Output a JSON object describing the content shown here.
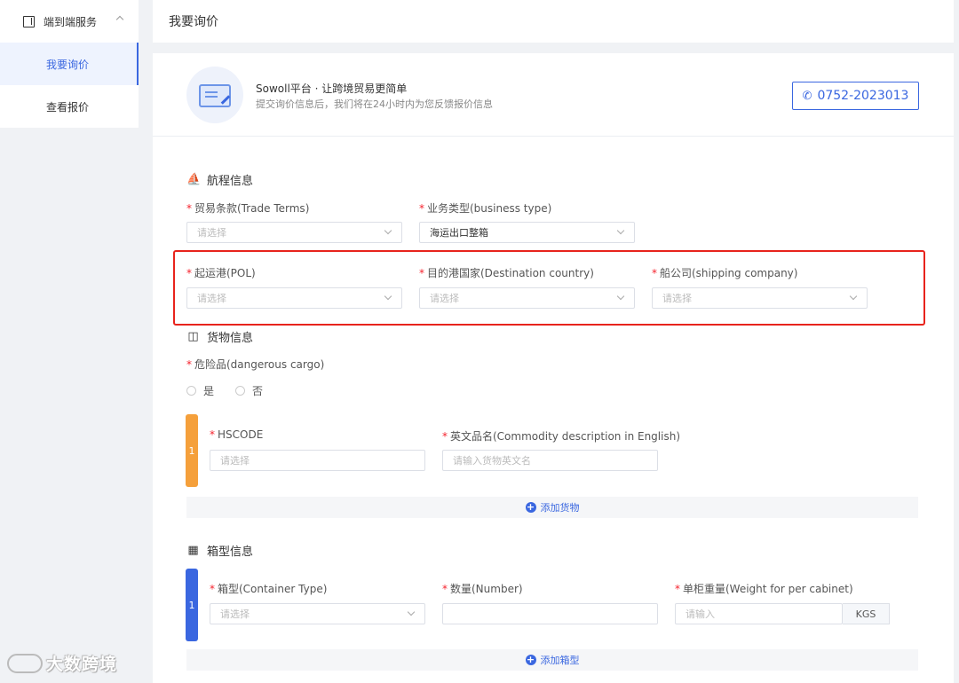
{
  "sidebar": {
    "group_label": "端到端服务",
    "items": [
      {
        "label": "我要询价",
        "active": true
      },
      {
        "label": "查看报价",
        "active": false
      }
    ]
  },
  "watermark": "大数跨境",
  "page_title": "我要询价",
  "hero": {
    "title": "Sowoll平台 · 让跨境贸易更简单",
    "subtitle": "提交询价信息后，我们将在24小时内为您反馈报价信息",
    "phone": "0752-2023013"
  },
  "voyage": {
    "title": "航程信息",
    "trade_terms_label": "贸易条款(Trade Terms)",
    "trade_terms_placeholder": "请选择",
    "business_type_label": "业务类型(business type)",
    "business_type_value": "海运出口整箱",
    "pol_label": "起运港(POL)",
    "pol_placeholder": "请选择",
    "destination_label": "目的港国家(Destination country)",
    "destination_placeholder": "请选择",
    "shipping_label": "船公司(shipping company)",
    "shipping_placeholder": "请选择"
  },
  "cargo": {
    "title": "货物信息",
    "dangerous_label": "危险品(dangerous cargo)",
    "yes_label": "是",
    "no_label": "否",
    "row_number": "1",
    "hscode_label": "HSCODE",
    "hscode_placeholder": "请选择",
    "commodity_label": "英文品名(Commodity description in English)",
    "commodity_placeholder": "请输入货物英文名",
    "add_label": "添加货物"
  },
  "container": {
    "title": "箱型信息",
    "row_number": "1",
    "type_label": "箱型(Container Type)",
    "type_placeholder": "请选择",
    "number_label": "数量(Number)",
    "weight_label": "单柜重量(Weight for per cabinet)",
    "weight_placeholder": "请输入",
    "weight_unit": "KGS",
    "add_label": "添加箱型"
  },
  "colors": {
    "accent": "#3a67e0",
    "required": "#f5222d",
    "cargo_row": "#f5a03b",
    "container_row": "#3a67e0",
    "highlight": "#e8231c"
  }
}
